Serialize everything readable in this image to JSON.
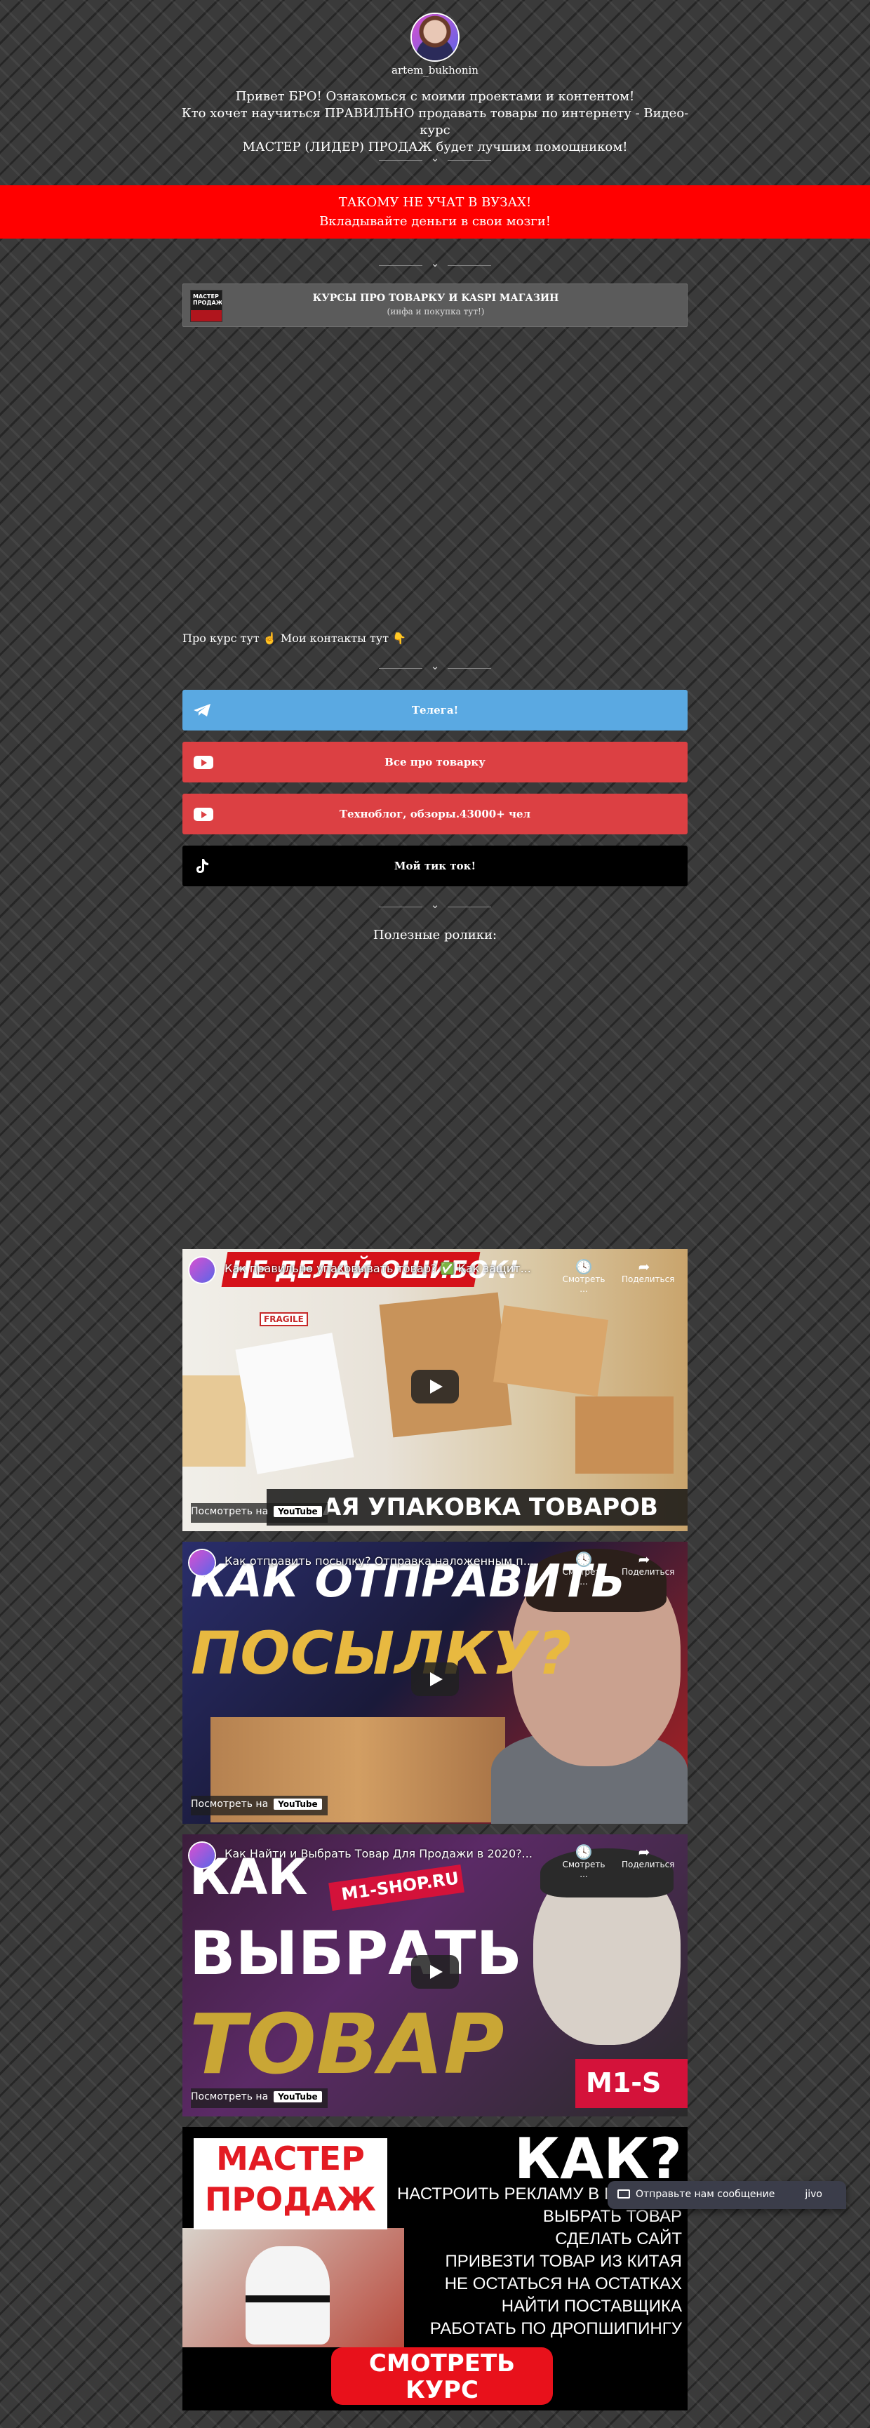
{
  "profile": {
    "username": "artem_bukhonin",
    "intro": [
      "Привет БРО! Ознакомься с моими проектами и контентом!",
      "Кто хочет научиться ПРАВИЛЬНО продавать товары по интернету - Видео-курс",
      "МАСТЕР (ЛИДЕР) ПРОДАЖ будет лучшим помощником!"
    ]
  },
  "banner": {
    "line1": "ТАКОМУ НЕ УЧАТ В ВУЗАХ!",
    "line2": "Вкладывайте деньги в свои мозги!",
    "color": "#ff0000"
  },
  "course_card": {
    "thumb_text": "МАСТЕР ПРОДАЖ",
    "title": "КУРСЫ ПРО ТОВАРКУ И KASPI МАГАЗИН",
    "subtitle": "(инфа и покупка тут!)"
  },
  "contacts_text": "Про курс тут ☝ Мои контакты тут 👇",
  "links": [
    {
      "label": "Телега!",
      "icon": "telegram-icon",
      "color": "#5aa9e2"
    },
    {
      "label": "Все про товарку",
      "icon": "youtube-icon",
      "color": "#dc4043"
    },
    {
      "label": "Техноблог, обзоры.43000+ чел",
      "icon": "youtube-icon",
      "color": "#dc4043"
    },
    {
      "label": "Мой тик ток!",
      "icon": "tiktok-icon",
      "color": "#000000"
    }
  ],
  "useful_title": "Полезные ролики:",
  "videos": [
    {
      "title": "Как правильно упаковывать товар? ✅ Как защит...",
      "watch_label": "Посмотреть на",
      "share_label": "Поделиться",
      "later_label": "Смотреть ...",
      "overlay_top": "НЕ ДЕЛАЙ ОШИБОК!",
      "overlay_bottom": "АЯ УПАКОВКА ТОВАРОВ",
      "label_fragile": "FRAGILE"
    },
    {
      "title": "Как отправить посылку? Отправка наложенным п...",
      "watch_label": "Посмотреть на",
      "share_label": "Поделиться",
      "later_label": "Смотреть ...",
      "overlay_top": "КАК ОТПРАВИТЬ",
      "overlay_bottom": "ПОСЫЛКУ?"
    },
    {
      "title": "Как Найти и Выбрать Товар Для Продажи в 2020?...",
      "watch_label": "Посмотреть на",
      "share_label": "Поделиться",
      "later_label": "Смотреть ...",
      "overlay_1": "КАК",
      "overlay_2": "ВЫБРАТЬ",
      "overlay_3": "ТОВАР",
      "badge_1": "M1-SHOP.RU",
      "badge_2": "M1-S"
    }
  ],
  "youtube_logo": "YouTube",
  "promo": {
    "brand_1": "МАСТЕР",
    "brand_2": "ПРОДАЖ",
    "kak": "КАК?",
    "lines": [
      "НАСТРОИТЬ РЕКЛАМУ В INS",
      "ВЫБРАТЬ ТОВАР",
      "СДЕЛАТЬ САЙТ",
      "ПРИВЕЗТИ ТОВАР ИЗ КИТАЯ",
      "НЕ ОСТАТЬСЯ НА ОСТАТКАХ",
      "НАЙТИ ПОСТАВЩИКА",
      "РАБОТАТЬ ПО ДРОПШИПИНГУ"
    ],
    "cta_1": "СМОТРЕТЬ",
    "cta_2": "КУРС"
  },
  "jivo": {
    "message": "Отправьте нам сообщение",
    "logo": "jivo"
  }
}
